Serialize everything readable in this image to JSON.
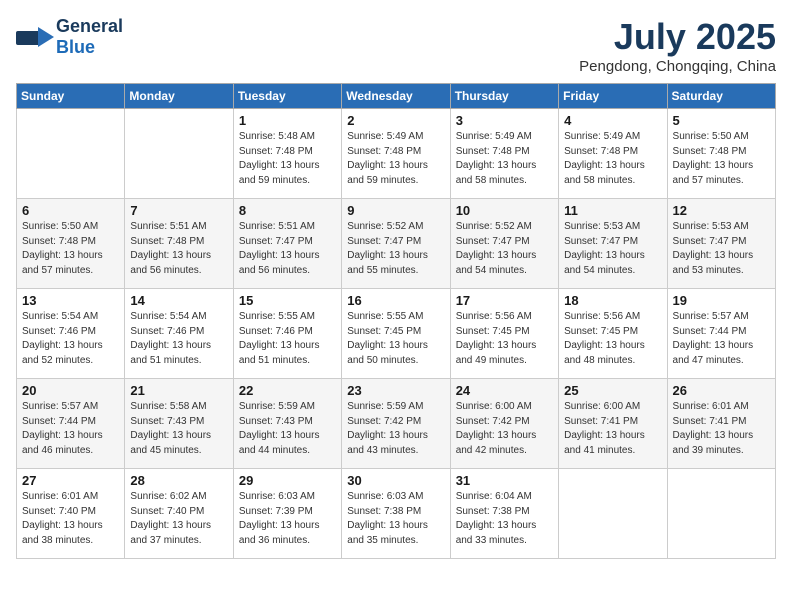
{
  "header": {
    "logo_general": "General",
    "logo_blue": "Blue",
    "month_title": "July 2025",
    "location": "Pengdong, Chongqing, China"
  },
  "days_of_week": [
    "Sunday",
    "Monday",
    "Tuesday",
    "Wednesday",
    "Thursday",
    "Friday",
    "Saturday"
  ],
  "weeks": [
    [
      {
        "day": "",
        "info": ""
      },
      {
        "day": "",
        "info": ""
      },
      {
        "day": "1",
        "info": "Sunrise: 5:48 AM\nSunset: 7:48 PM\nDaylight: 13 hours and 59 minutes."
      },
      {
        "day": "2",
        "info": "Sunrise: 5:49 AM\nSunset: 7:48 PM\nDaylight: 13 hours and 59 minutes."
      },
      {
        "day": "3",
        "info": "Sunrise: 5:49 AM\nSunset: 7:48 PM\nDaylight: 13 hours and 58 minutes."
      },
      {
        "day": "4",
        "info": "Sunrise: 5:49 AM\nSunset: 7:48 PM\nDaylight: 13 hours and 58 minutes."
      },
      {
        "day": "5",
        "info": "Sunrise: 5:50 AM\nSunset: 7:48 PM\nDaylight: 13 hours and 57 minutes."
      }
    ],
    [
      {
        "day": "6",
        "info": "Sunrise: 5:50 AM\nSunset: 7:48 PM\nDaylight: 13 hours and 57 minutes."
      },
      {
        "day": "7",
        "info": "Sunrise: 5:51 AM\nSunset: 7:48 PM\nDaylight: 13 hours and 56 minutes."
      },
      {
        "day": "8",
        "info": "Sunrise: 5:51 AM\nSunset: 7:47 PM\nDaylight: 13 hours and 56 minutes."
      },
      {
        "day": "9",
        "info": "Sunrise: 5:52 AM\nSunset: 7:47 PM\nDaylight: 13 hours and 55 minutes."
      },
      {
        "day": "10",
        "info": "Sunrise: 5:52 AM\nSunset: 7:47 PM\nDaylight: 13 hours and 54 minutes."
      },
      {
        "day": "11",
        "info": "Sunrise: 5:53 AM\nSunset: 7:47 PM\nDaylight: 13 hours and 54 minutes."
      },
      {
        "day": "12",
        "info": "Sunrise: 5:53 AM\nSunset: 7:47 PM\nDaylight: 13 hours and 53 minutes."
      }
    ],
    [
      {
        "day": "13",
        "info": "Sunrise: 5:54 AM\nSunset: 7:46 PM\nDaylight: 13 hours and 52 minutes."
      },
      {
        "day": "14",
        "info": "Sunrise: 5:54 AM\nSunset: 7:46 PM\nDaylight: 13 hours and 51 minutes."
      },
      {
        "day": "15",
        "info": "Sunrise: 5:55 AM\nSunset: 7:46 PM\nDaylight: 13 hours and 51 minutes."
      },
      {
        "day": "16",
        "info": "Sunrise: 5:55 AM\nSunset: 7:45 PM\nDaylight: 13 hours and 50 minutes."
      },
      {
        "day": "17",
        "info": "Sunrise: 5:56 AM\nSunset: 7:45 PM\nDaylight: 13 hours and 49 minutes."
      },
      {
        "day": "18",
        "info": "Sunrise: 5:56 AM\nSunset: 7:45 PM\nDaylight: 13 hours and 48 minutes."
      },
      {
        "day": "19",
        "info": "Sunrise: 5:57 AM\nSunset: 7:44 PM\nDaylight: 13 hours and 47 minutes."
      }
    ],
    [
      {
        "day": "20",
        "info": "Sunrise: 5:57 AM\nSunset: 7:44 PM\nDaylight: 13 hours and 46 minutes."
      },
      {
        "day": "21",
        "info": "Sunrise: 5:58 AM\nSunset: 7:43 PM\nDaylight: 13 hours and 45 minutes."
      },
      {
        "day": "22",
        "info": "Sunrise: 5:59 AM\nSunset: 7:43 PM\nDaylight: 13 hours and 44 minutes."
      },
      {
        "day": "23",
        "info": "Sunrise: 5:59 AM\nSunset: 7:42 PM\nDaylight: 13 hours and 43 minutes."
      },
      {
        "day": "24",
        "info": "Sunrise: 6:00 AM\nSunset: 7:42 PM\nDaylight: 13 hours and 42 minutes."
      },
      {
        "day": "25",
        "info": "Sunrise: 6:00 AM\nSunset: 7:41 PM\nDaylight: 13 hours and 41 minutes."
      },
      {
        "day": "26",
        "info": "Sunrise: 6:01 AM\nSunset: 7:41 PM\nDaylight: 13 hours and 39 minutes."
      }
    ],
    [
      {
        "day": "27",
        "info": "Sunrise: 6:01 AM\nSunset: 7:40 PM\nDaylight: 13 hours and 38 minutes."
      },
      {
        "day": "28",
        "info": "Sunrise: 6:02 AM\nSunset: 7:40 PM\nDaylight: 13 hours and 37 minutes."
      },
      {
        "day": "29",
        "info": "Sunrise: 6:03 AM\nSunset: 7:39 PM\nDaylight: 13 hours and 36 minutes."
      },
      {
        "day": "30",
        "info": "Sunrise: 6:03 AM\nSunset: 7:38 PM\nDaylight: 13 hours and 35 minutes."
      },
      {
        "day": "31",
        "info": "Sunrise: 6:04 AM\nSunset: 7:38 PM\nDaylight: 13 hours and 33 minutes."
      },
      {
        "day": "",
        "info": ""
      },
      {
        "day": "",
        "info": ""
      }
    ]
  ]
}
